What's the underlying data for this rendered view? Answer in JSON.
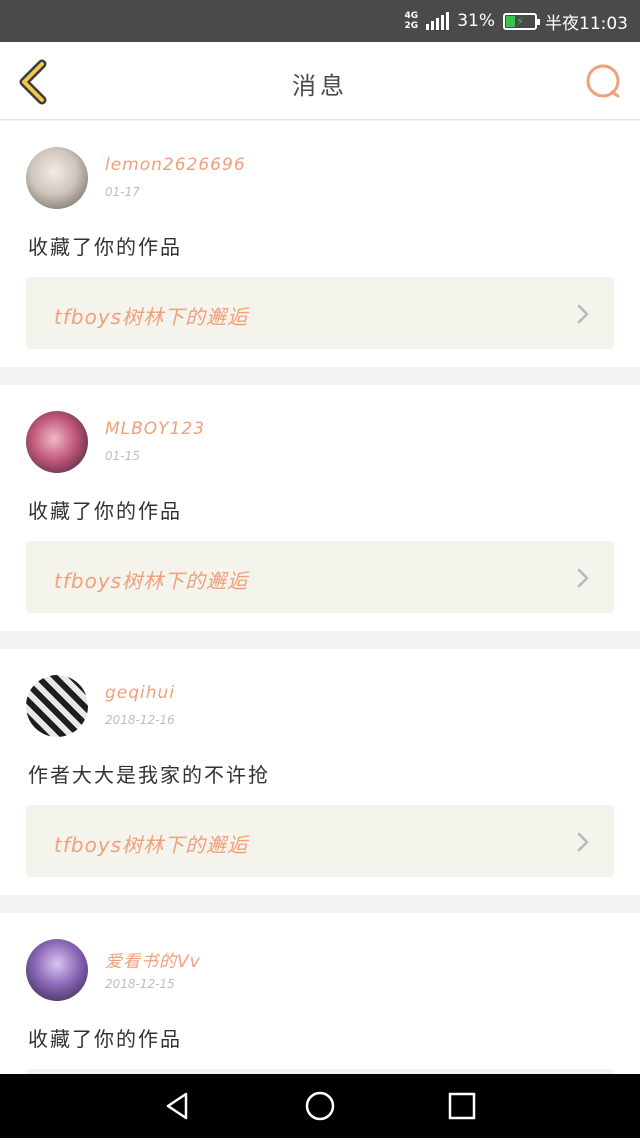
{
  "status_bar": {
    "network_top": "4G",
    "network_bottom": "2G",
    "battery_percent": "31%",
    "time": "半夜11:03",
    "battery_color": "#3cc24f"
  },
  "header": {
    "title": "消息",
    "back_icon": "chevron-left-icon",
    "search_icon": "search-icon"
  },
  "colors": {
    "accent": "#f0a07a",
    "header_icon": "#e6a23c",
    "card_link_bg": "#f4f3ec"
  },
  "messages": [
    {
      "username": "lemon2626696",
      "date": "01-17",
      "action": "收藏了你的作品",
      "work_title": "tfboys树林下的邂逅"
    },
    {
      "username": "MLBOY123",
      "date": "01-15",
      "action": "收藏了你的作品",
      "work_title": "tfboys树林下的邂逅"
    },
    {
      "username": "geqihui",
      "date": "2018-12-16",
      "action": "作者大大是我家的不许抢",
      "work_title": "tfboys树林下的邂逅"
    },
    {
      "username": "爱看书的Vv",
      "date": "2018-12-15",
      "action": "收藏了你的作品",
      "work_title": ""
    }
  ],
  "nav_bar": {
    "back_icon": "triangle-back-icon",
    "home_icon": "circle-home-icon",
    "recent_icon": "square-recent-icon"
  }
}
